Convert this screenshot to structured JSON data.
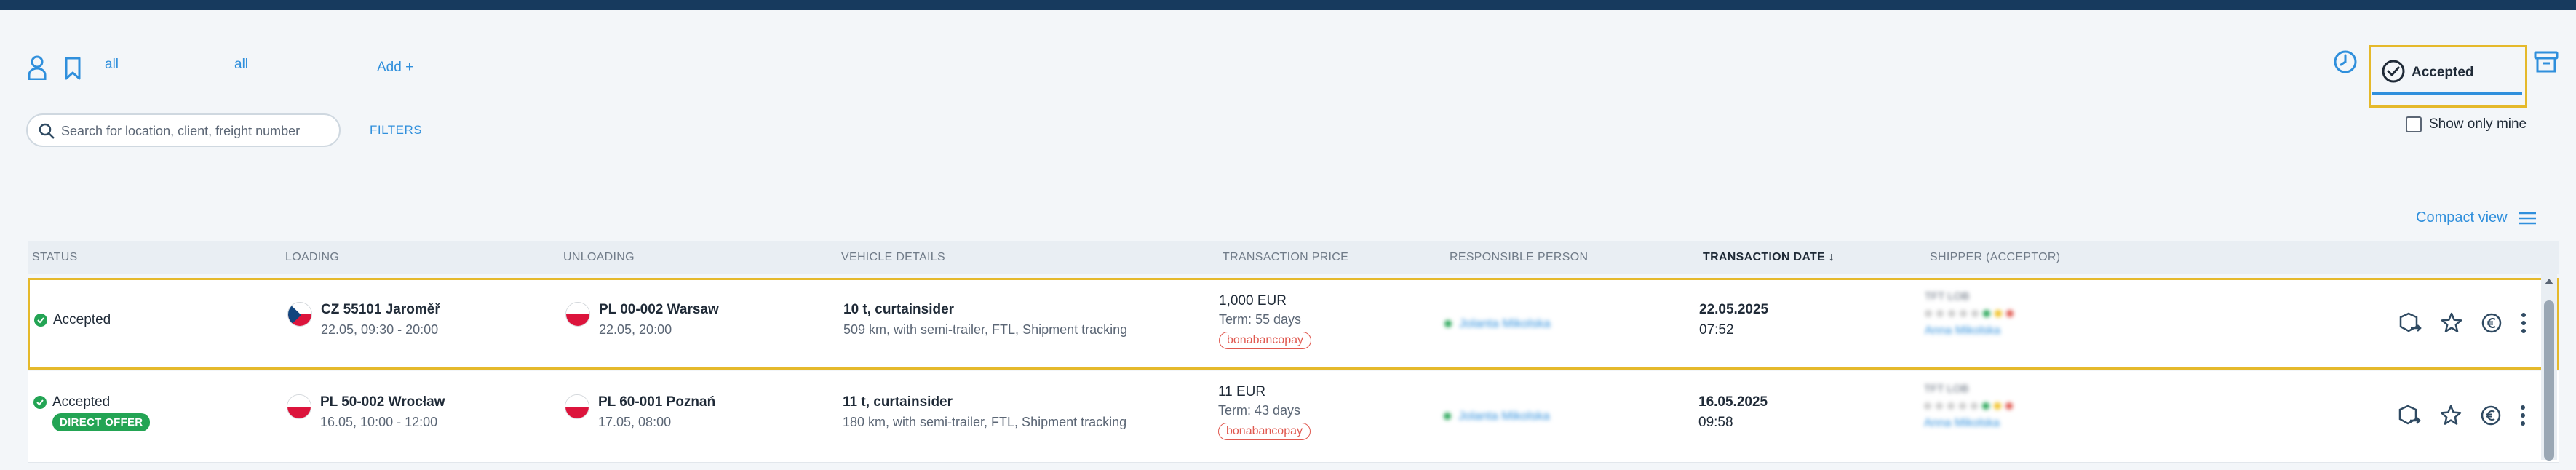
{
  "filters": {
    "link_all_1": "all",
    "link_all_2": "all",
    "add_label": "Add +",
    "search_placeholder": "Search for location, client, freight number",
    "filters_label": "FILTERS"
  },
  "tabs": {
    "accepted_label": "Accepted"
  },
  "show_mine_label": "Show only mine",
  "compact_view_label": "Compact view",
  "table": {
    "headers": [
      "STATUS",
      "LOADING",
      "UNLOADING",
      "VEHICLE DETAILS",
      "TRANSACTION PRICE",
      "RESPONSIBLE PERSON",
      "TRANSACTION DATE ↓",
      "SHIPPER (ACCEPTOR)"
    ],
    "rows": [
      {
        "status": "Accepted",
        "badge": "",
        "loading_place": "CZ 55101 Jaroměř",
        "loading_time": "22.05, 09:30 - 20:00",
        "unloading_place": "PL 00-002 Warsaw",
        "unloading_time": "22.05, 20:00",
        "vehicle": "10 t, curtainsider",
        "vehicle_details": "509 km, with semi-trailer, FTL, Shipment tracking",
        "price": "1,000 EUR",
        "term": "Term: 55 days",
        "pay_badge": "bonabancopay",
        "person": "Jolanta Mikolska",
        "date": "22.05.2025",
        "time": "07:52",
        "shipper_name": "TFT LOB",
        "shipper_person": "Anna Mikolska"
      },
      {
        "status": "Accepted",
        "badge": "DIRECT OFFER",
        "loading_place": "PL 50-002 Wrocław",
        "loading_time": "16.05, 10:00 - 12:00",
        "unloading_place": "PL 60-001 Poznań",
        "unloading_time": "17.05, 08:00",
        "vehicle": "11 t, curtainsider",
        "vehicle_details": "180 km, with semi-trailer, FTL, Shipment tracking",
        "price": "11 EUR",
        "term": "Term: 43 days",
        "pay_badge": "bonabancopay",
        "person": "Jolanta Mikolska",
        "date": "16.05.2025",
        "time": "09:58",
        "shipper_name": "TFT LOB",
        "shipper_person": "Anna Mikolska"
      }
    ]
  },
  "colors": {
    "accent": "#2f8fdc",
    "highlight": "#e5b92b",
    "success": "#23a454",
    "topbar": "#173a5e"
  }
}
